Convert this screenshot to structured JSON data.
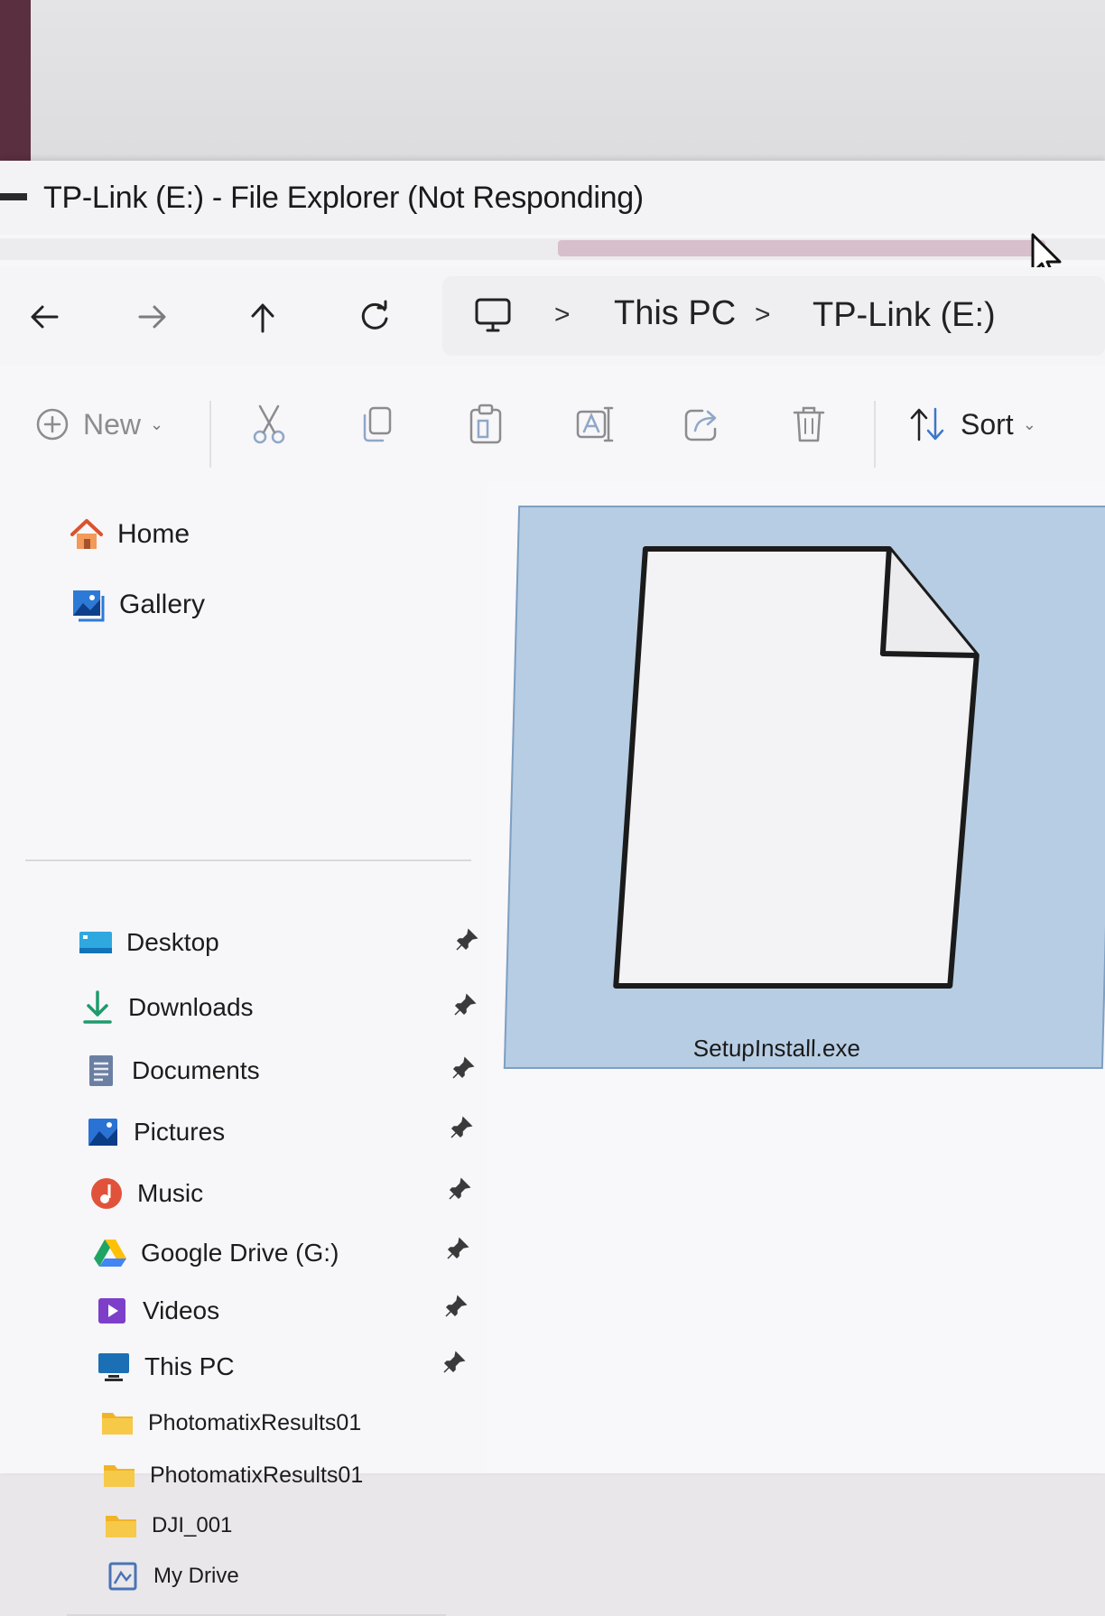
{
  "window": {
    "title": "TP-Link (E:) - File Explorer (Not Responding)"
  },
  "address_bar": {
    "crumbs": [
      "This PC",
      "TP-Link (E:)"
    ],
    "separator": ">"
  },
  "toolbar": {
    "new_label": "New",
    "sort_label": "Sort"
  },
  "sidebar": {
    "top_items": [
      {
        "label": "Home",
        "icon": "home-icon"
      },
      {
        "label": "Gallery",
        "icon": "gallery-icon"
      }
    ],
    "pinned_items": [
      {
        "label": "Desktop",
        "icon": "desktop-icon"
      },
      {
        "label": "Downloads",
        "icon": "download-icon"
      },
      {
        "label": "Documents",
        "icon": "documents-icon"
      },
      {
        "label": "Pictures",
        "icon": "pictures-icon"
      },
      {
        "label": "Music",
        "icon": "music-icon"
      },
      {
        "label": "Google Drive (G:)",
        "icon": "google-drive-icon"
      },
      {
        "label": "Videos",
        "icon": "videos-icon"
      },
      {
        "label": "This PC",
        "icon": "monitor-icon"
      }
    ],
    "folders": [
      {
        "label": "PhotomatixResults01",
        "icon": "folder-icon"
      },
      {
        "label": "PhotomatixResults01",
        "icon": "folder-icon"
      },
      {
        "label": "DJI_001",
        "icon": "folder-icon"
      },
      {
        "label": "My Drive",
        "icon": "drive-folder-icon"
      }
    ]
  },
  "files": [
    {
      "name": "SetupInstall.exe",
      "icon": "generic-file-icon",
      "selected": true
    }
  ],
  "colors": {
    "selection": "#b7cde4",
    "progress": "#d7bfcc",
    "folder": "#f0b429"
  }
}
